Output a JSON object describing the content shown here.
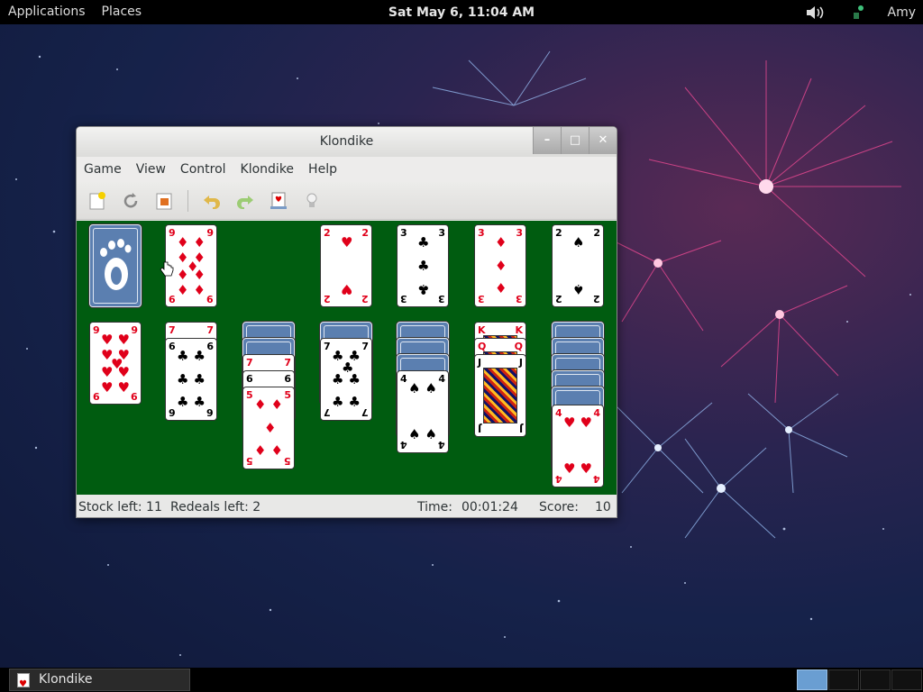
{
  "top_panel": {
    "applications": "Applications",
    "places": "Places",
    "clock": "Sat May  6, 11:04 AM",
    "user": "Amy"
  },
  "window": {
    "title": "Klondike",
    "menu": [
      "Game",
      "View",
      "Control",
      "Klondike",
      "Help"
    ],
    "toolbar_icons": [
      "new-game-icon",
      "restart-icon",
      "select-game-icon",
      "undo-icon",
      "redo-icon",
      "deal-icon",
      "hint-icon"
    ]
  },
  "status": {
    "stock_left": "Stock left: 11",
    "redeals_left": "Redeals left: 2",
    "time_label": "Time:",
    "time_value": "00:01:24",
    "score_label": "Score:",
    "score_value": "10"
  },
  "cards": {
    "waste": {
      "rank": "9",
      "suit": "♦"
    },
    "foundations": [
      {
        "rank": "2",
        "suit": "♥"
      },
      {
        "rank": "3",
        "suit": "♣"
      },
      {
        "rank": "3",
        "suit": "♦"
      },
      {
        "rank": "2",
        "suit": "♠"
      }
    ],
    "tableau": [
      {
        "hidden": 0,
        "faceup": [
          {
            "rank": "9",
            "suit": "♥"
          }
        ]
      },
      {
        "hidden": 0,
        "faceup": [
          {
            "rank": "7",
            "suit": "♦"
          },
          {
            "rank": "6",
            "suit": "♣"
          }
        ]
      },
      {
        "hidden": 2,
        "faceup": [
          {
            "rank": "7",
            "suit": "♥"
          },
          {
            "rank": "6",
            "suit": "♠"
          },
          {
            "rank": "5",
            "suit": "♦"
          }
        ]
      },
      {
        "hidden": 1,
        "faceup": [
          {
            "rank": "7",
            "suit": "♣"
          }
        ]
      },
      {
        "hidden": 3,
        "faceup": [
          {
            "rank": "4",
            "suit": "♠"
          }
        ]
      },
      {
        "hidden": 0,
        "faceup": [
          {
            "rank": "K",
            "suit": "♦"
          },
          {
            "rank": "Q",
            "suit": "♠"
          },
          {
            "rank": "J",
            "suit": "♦"
          }
        ]
      },
      {
        "hidden": 5,
        "faceup": [
          {
            "rank": "4",
            "suit": "♥"
          }
        ]
      }
    ]
  },
  "taskbar": {
    "task_label": "Klondike"
  },
  "colors": {
    "felt": "#005c10",
    "card_back": "#5b7fb0"
  }
}
